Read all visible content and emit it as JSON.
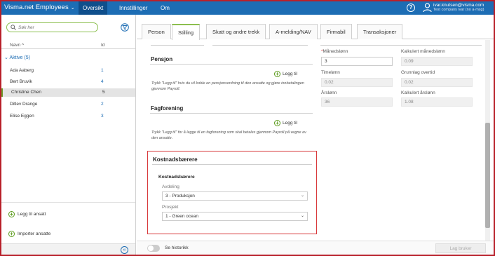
{
  "app": {
    "title": "Visma.net Employees",
    "nav": [
      "Oversikt",
      "Innstillinger",
      "Om"
    ]
  },
  "user": {
    "email": "ivar.knutsen@visma.com",
    "company": "Test company ivar (no a-msg)"
  },
  "left": {
    "search_placeholder": "Søk her",
    "col_name": "Navn ^",
    "col_id": "Id",
    "group": "Aktive (5)",
    "employees": [
      {
        "name": "Ada Aaberg",
        "id": "1"
      },
      {
        "name": "Bert Bruvik",
        "id": "4"
      },
      {
        "name": "Christine Chen",
        "id": "5"
      },
      {
        "name": "Ditlev Drange",
        "id": "2"
      },
      {
        "name": "Elise Eggen",
        "id": "3"
      }
    ],
    "add_employee": "Legg til ansatt",
    "import_employees": "Importer ansatte"
  },
  "tabs": [
    "Person",
    "Stilling",
    "Skatt og andre trekk",
    "A-melding/NAV",
    "Firmabil",
    "Transaksjoner"
  ],
  "pension": {
    "title": "Pensjon",
    "add": "Legg til",
    "help": "Trykk \"Legg til\" hvis du vil koble en pensjonsordning til den ansatte og gjøre innbetalingen gjennom Payroll."
  },
  "union": {
    "title": "Fagforening",
    "add": "Legg til",
    "help": "Trykk \"Legg til\" for å legge til en fagforening som skal betales gjennom Payroll på vegne av den ansatte."
  },
  "cost": {
    "title": "Kostnadsbærere",
    "subtitle": "Kostnadsbærere",
    "dept_label": "Avdeling",
    "dept_value": "3 - Produksjon",
    "project_label": "Prosjekt",
    "project_value": "1 - Green ocean"
  },
  "pay": {
    "monthly_label": "Månedslønn",
    "monthly_value": "3",
    "calc_monthly_label": "Kalkulert månedslønn",
    "calc_monthly_value": "0.09",
    "hourly_label": "Timelønn",
    "hourly_value": "0.02",
    "overtime_label": "Grunnlag overtid",
    "overtime_value": "0.02",
    "yearly_label": "Årslønn",
    "yearly_value": "36",
    "calc_yearly_label": "Kalkulert årslønn",
    "calc_yearly_value": "1.08"
  },
  "bottom": {
    "history_label": "Se historikk",
    "save_label": "Lag bruker"
  }
}
